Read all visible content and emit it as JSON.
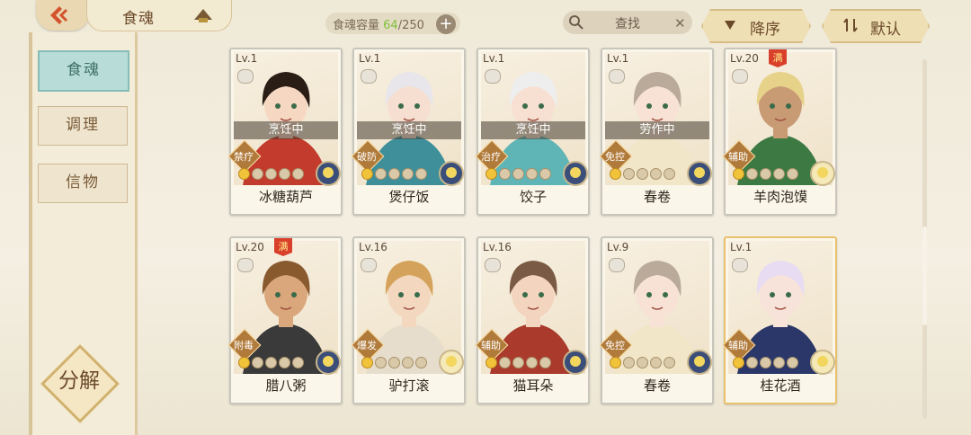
{
  "header": {
    "title": "食魂",
    "capacity_label": "食魂容量",
    "capacity_current": "64",
    "capacity_total": "/250",
    "plus": "+",
    "search_placeholder": "查找",
    "sort_desc": "降序",
    "sort_default": "默认"
  },
  "sidebar": {
    "items": [
      {
        "label": "食魂"
      },
      {
        "label": "调理"
      },
      {
        "label": "信物"
      }
    ],
    "decompose": "分解"
  },
  "cards": [
    {
      "lv": "Lv.1",
      "name": "冰糖葫芦",
      "status": "烹饪中",
      "role": "禁疗",
      "stars": 1,
      "full": false,
      "hair": "#2a1d16",
      "skin": "#f6d8c2",
      "outfit": "#c23b2c"
    },
    {
      "lv": "Lv.1",
      "name": "煲仔饭",
      "status": "烹饪中",
      "role": "破防",
      "stars": 1,
      "full": false,
      "hair": "#e8e6ea",
      "skin": "#f6dfd0",
      "outfit": "#3f8f9a"
    },
    {
      "lv": "Lv.1",
      "name": "饺子",
      "status": "烹饪中",
      "role": "治疗",
      "stars": 1,
      "full": false,
      "hair": "#eeeeee",
      "skin": "#f7e0d2",
      "outfit": "#5fb4b5"
    },
    {
      "lv": "Lv.1",
      "name": "春卷",
      "status": "劳作中",
      "role": "免控",
      "stars": 1,
      "full": false,
      "hair": "#b9aa99",
      "skin": "#f8e2d5",
      "outfit": "#f2e6c9"
    },
    {
      "lv": "Lv.20",
      "name": "羊肉泡馍",
      "status": "",
      "role": "辅助",
      "stars": 1,
      "full": true,
      "hair": "#e7d28a",
      "skin": "#c99b75",
      "outfit": "#3d7a43"
    },
    {
      "lv": "Lv.20",
      "name": "腊八粥",
      "status": "",
      "role": "附毒",
      "stars": 1,
      "full": true,
      "hair": "#8a5a2f",
      "skin": "#d9a77b",
      "outfit": "#3a3a3a"
    },
    {
      "lv": "Lv.16",
      "name": "驴打滚",
      "status": "",
      "role": "爆发",
      "stars": 1,
      "full": false,
      "hair": "#d4a25a",
      "skin": "#f3d7bf",
      "outfit": "#e7ddcc"
    },
    {
      "lv": "Lv.16",
      "name": "猫耳朵",
      "status": "",
      "role": "辅助",
      "stars": 1,
      "full": false,
      "hair": "#7a5a44",
      "skin": "#f3d5bf",
      "outfit": "#a93a2c"
    },
    {
      "lv": "Lv.9",
      "name": "春卷",
      "status": "",
      "role": "免控",
      "stars": 1,
      "full": false,
      "hair": "#b9aa99",
      "skin": "#f8e2d5",
      "outfit": "#f2e6c9"
    },
    {
      "lv": "Lv.1",
      "name": "桂花酒",
      "status": "",
      "role": "辅助",
      "stars": 1,
      "full": false,
      "hair": "#e7dcf2",
      "skin": "#f8e3da",
      "outfit": "#2a3768"
    }
  ],
  "full_mark": "满"
}
